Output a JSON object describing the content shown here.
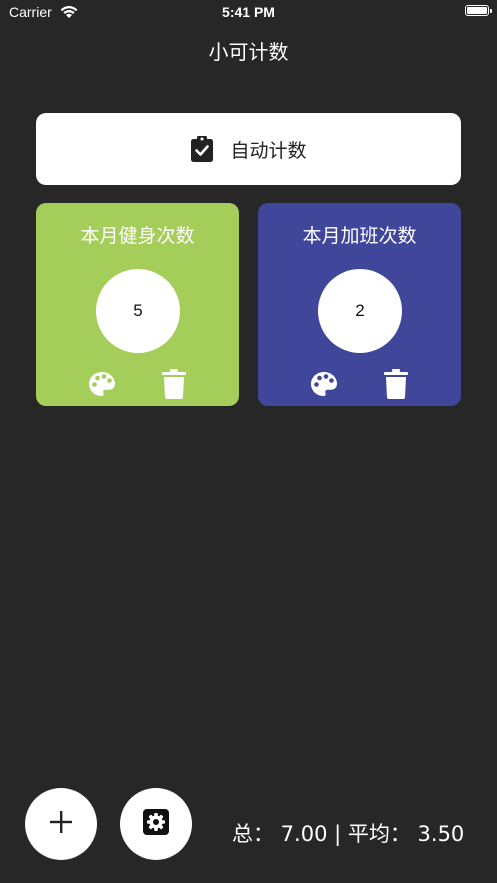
{
  "status_bar": {
    "carrier": "Carrier",
    "time": "5:41 PM",
    "wifi_icon": "wifi-icon",
    "battery_icon": "battery-icon"
  },
  "nav": {
    "title": "小可计数"
  },
  "auto_count": {
    "label": "自动计数",
    "icon": "clipboard-check-icon"
  },
  "counters": [
    {
      "title": "本月健身次数",
      "count": "5",
      "color": "#a5cd59",
      "icons": [
        "palette-icon",
        "trash-icon"
      ]
    },
    {
      "title": "本月加班次数",
      "count": "2",
      "color": "#40479b",
      "icons": [
        "palette-icon",
        "trash-icon"
      ]
    }
  ],
  "bottom_bar": {
    "add_icon": "plus-icon",
    "settings_icon": "gear-icon",
    "summary": "总： 7.00 | 平均： 3.50"
  },
  "colors": {
    "background": "#272727",
    "card_text": "#ffffff"
  }
}
